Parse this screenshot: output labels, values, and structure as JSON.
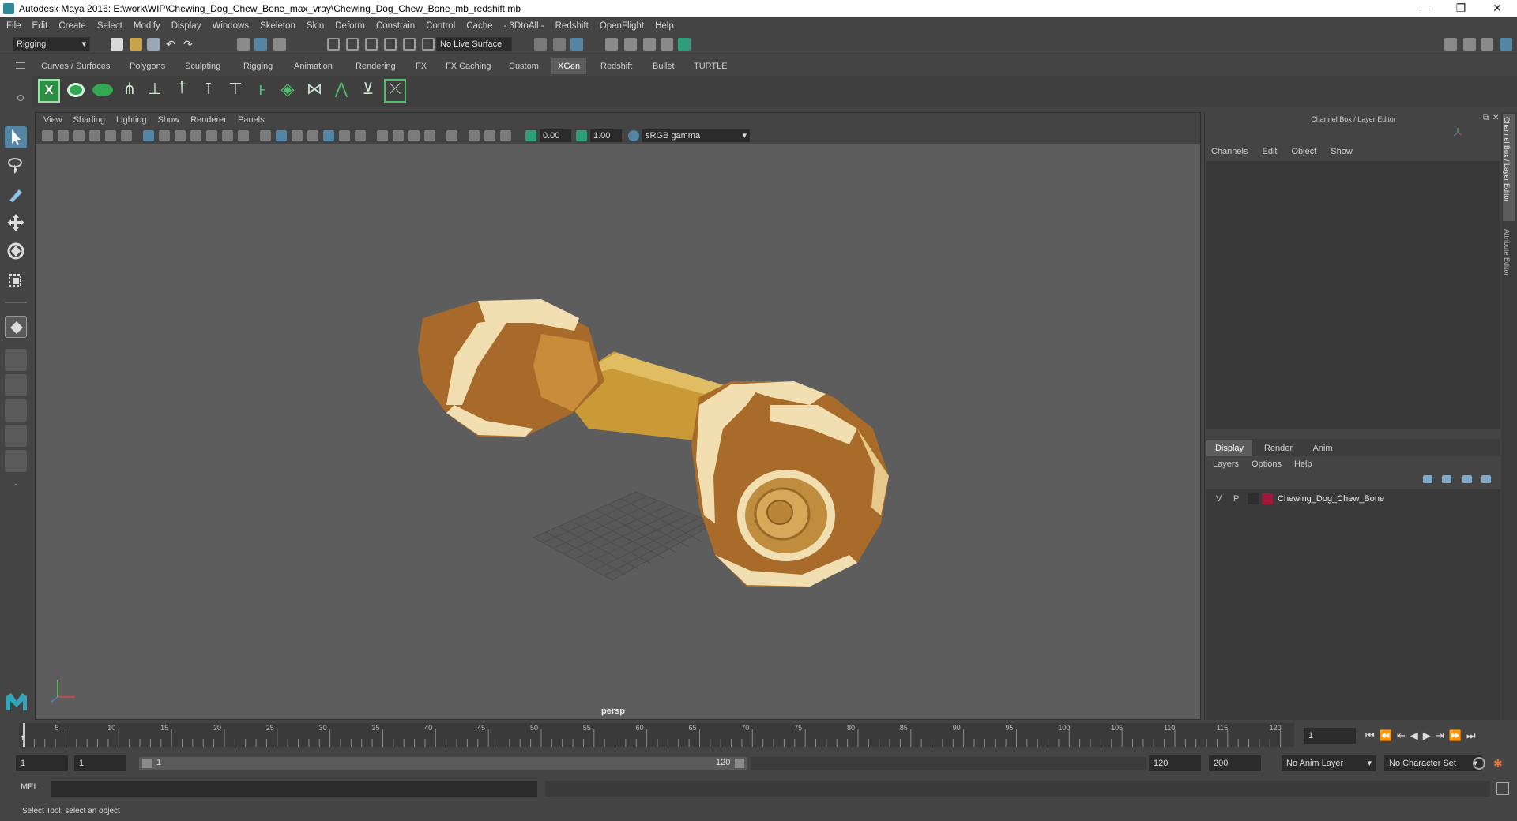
{
  "window": {
    "title": "Autodesk Maya 2016: E:\\work\\WIP\\Chewing_Dog_Chew_Bone_max_vray\\Chewing_Dog_Chew_Bone_mb_redshift.mb",
    "controls": {
      "minimize": "—",
      "restore": "❐",
      "close": "✕"
    }
  },
  "menubar": [
    "File",
    "Edit",
    "Create",
    "Select",
    "Modify",
    "Display",
    "Windows",
    "Skeleton",
    "Skin",
    "Deform",
    "Constrain",
    "Control",
    "Cache",
    "- 3DtoAll -",
    "Redshift",
    "OpenFlight",
    "Help"
  ],
  "statusline": {
    "mode": "Rigging",
    "live_surface": "No Live Surface"
  },
  "shelf_tabs": [
    {
      "label": "Curves / Surfaces",
      "active": false
    },
    {
      "label": "Polygons",
      "active": false
    },
    {
      "label": "Sculpting",
      "active": false
    },
    {
      "label": "Rigging",
      "active": false
    },
    {
      "label": "Animation",
      "active": false
    },
    {
      "label": "Rendering",
      "active": false
    },
    {
      "label": "FX",
      "active": false
    },
    {
      "label": "FX Caching",
      "active": false
    },
    {
      "label": "Custom",
      "active": false
    },
    {
      "label": "XGen",
      "active": true
    },
    {
      "label": "Redshift",
      "active": false
    },
    {
      "label": "Bullet",
      "active": false
    },
    {
      "label": "TURTLE",
      "active": false
    }
  ],
  "viewport": {
    "menus": [
      "View",
      "Shading",
      "Lighting",
      "Show",
      "Renderer",
      "Panels"
    ],
    "exposure": "0.00",
    "gamma": "1.00",
    "color_space": "sRGB gamma",
    "camera_label": "persp"
  },
  "channel_box": {
    "title": "Channel Box / Layer Editor",
    "menus": [
      "Channels",
      "Edit",
      "Object",
      "Show"
    ],
    "side_tabs": [
      "Channel Box / Layer Editor",
      "Attribute Editor"
    ]
  },
  "layer_editor": {
    "tabs": [
      {
        "label": "Display",
        "active": true
      },
      {
        "label": "Render",
        "active": false
      },
      {
        "label": "Anim",
        "active": false
      }
    ],
    "menus": [
      "Layers",
      "Options",
      "Help"
    ],
    "layers": [
      {
        "v": "V",
        "p": "P",
        "color": "#a0173a",
        "name": "Chewing_Dog_Chew_Bone"
      }
    ]
  },
  "timeline": {
    "ticks": [
      "5",
      "10",
      "15",
      "20",
      "25",
      "30",
      "35",
      "40",
      "45",
      "50",
      "55",
      "60",
      "65",
      "70",
      "75",
      "80",
      "85",
      "90",
      "95",
      "100",
      "105",
      "110",
      "115",
      "120"
    ],
    "start_marker": "1",
    "current_frame": "1"
  },
  "range": {
    "start": "1",
    "playback_start": "1",
    "slider_start": "1",
    "slider_end": "120",
    "playback_end": "120",
    "end": "200",
    "anim_layer": "No Anim Layer",
    "character_set": "No Character Set"
  },
  "command_line": {
    "language": "MEL"
  },
  "help_line": {
    "text": "Select Tool: select an object"
  },
  "colors": {
    "accent": "#5285a6",
    "shelf_green": "#33a853",
    "layer_color": "#a0173a",
    "viewport_bg": "#5d5d5d"
  }
}
